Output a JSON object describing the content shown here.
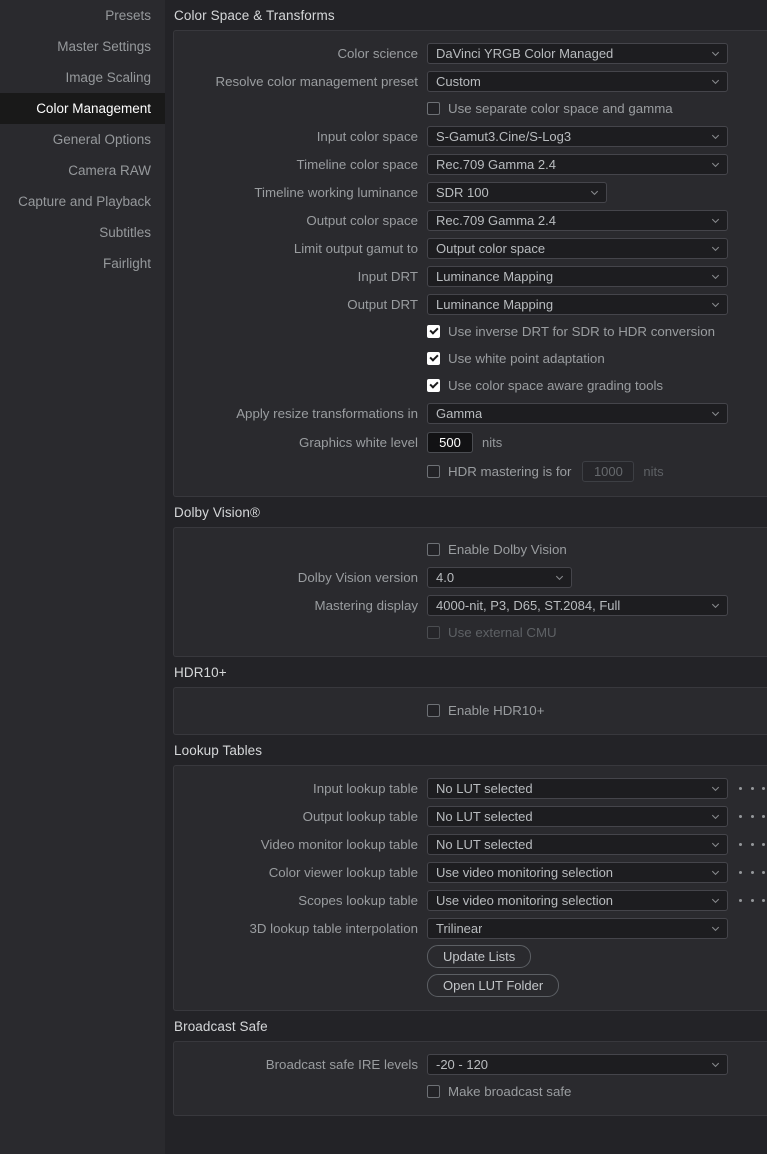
{
  "sidebar": {
    "items": [
      {
        "label": "Presets",
        "active": false
      },
      {
        "label": "Master Settings",
        "active": false
      },
      {
        "label": "Image Scaling",
        "active": false
      },
      {
        "label": "Color Management",
        "active": true
      },
      {
        "label": "General Options",
        "active": false
      },
      {
        "label": "Camera RAW",
        "active": false
      },
      {
        "label": "Capture and Playback",
        "active": false
      },
      {
        "label": "Subtitles",
        "active": false
      },
      {
        "label": "Fairlight",
        "active": false
      }
    ]
  },
  "sections": {
    "color_space_transforms": {
      "title": "Color Space & Transforms",
      "color_science": {
        "label": "Color science",
        "value": "DaVinci YRGB Color Managed"
      },
      "preset": {
        "label": "Resolve color management preset",
        "value": "Custom"
      },
      "separate_cs_gamma": {
        "label": "Use separate color space and gamma",
        "checked": false
      },
      "input_color_space": {
        "label": "Input color space",
        "value": "S-Gamut3.Cine/S-Log3"
      },
      "timeline_color_space": {
        "label": "Timeline color space",
        "value": "Rec.709 Gamma 2.4"
      },
      "timeline_working_luminance": {
        "label": "Timeline working luminance",
        "value": "SDR 100"
      },
      "output_color_space": {
        "label": "Output color space",
        "value": "Rec.709 Gamma 2.4"
      },
      "limit_output_gamut": {
        "label": "Limit output gamut to",
        "value": "Output color space"
      },
      "input_drt": {
        "label": "Input DRT",
        "value": "Luminance Mapping"
      },
      "output_drt": {
        "label": "Output DRT",
        "value": "Luminance Mapping"
      },
      "inverse_drt": {
        "label": "Use inverse DRT for SDR to HDR conversion",
        "checked": true
      },
      "white_point_adaptation": {
        "label": "Use white point adaptation",
        "checked": true
      },
      "cs_aware_grading": {
        "label": "Use color space aware grading tools",
        "checked": true
      },
      "apply_resize": {
        "label": "Apply resize transformations in",
        "value": "Gamma"
      },
      "graphics_white_level": {
        "label": "Graphics white level",
        "value": "500",
        "unit": "nits"
      },
      "hdr_mastering": {
        "label": "HDR mastering is for",
        "checked": false,
        "value": "1000",
        "unit": "nits"
      }
    },
    "dolby_vision": {
      "title": "Dolby Vision®",
      "enable": {
        "label": "Enable Dolby Vision",
        "checked": false
      },
      "version": {
        "label": "Dolby Vision version",
        "value": "4.0"
      },
      "mastering_display": {
        "label": "Mastering display",
        "value": "4000-nit, P3, D65, ST.2084, Full"
      },
      "external_cmu": {
        "label": "Use external CMU",
        "checked": false
      }
    },
    "hdr10plus": {
      "title": "HDR10+",
      "enable": {
        "label": "Enable HDR10+",
        "checked": false
      }
    },
    "lookup_tables": {
      "title": "Lookup Tables",
      "rows": [
        {
          "label": "Input lookup table",
          "value": "No LUT selected",
          "has_browse": true
        },
        {
          "label": "Output lookup table",
          "value": "No LUT selected",
          "has_browse": true
        },
        {
          "label": "Video monitor lookup table",
          "value": "No LUT selected",
          "has_browse": true
        },
        {
          "label": "Color viewer lookup table",
          "value": "Use video monitoring selection",
          "has_browse": true
        },
        {
          "label": "Scopes lookup table",
          "value": "Use video monitoring selection",
          "has_browse": true
        },
        {
          "label": "3D lookup table interpolation",
          "value": "Trilinear",
          "has_browse": false
        }
      ],
      "update_lists_button": "Update Lists",
      "open_lut_folder_button": "Open LUT Folder"
    },
    "broadcast_safe": {
      "title": "Broadcast Safe",
      "ire_levels": {
        "label": "Broadcast safe IRE levels",
        "value": "-20 - 120"
      },
      "make_safe": {
        "label": "Make broadcast safe",
        "checked": false
      }
    }
  },
  "icons": {
    "chevron_down": "chevron-down-icon",
    "ellipsis": "ellipsis-icon",
    "checkmark": "check-icon"
  },
  "colors": {
    "background": "#232327",
    "panel": "#2a2a2e",
    "sidebar": "#2a2a2e",
    "active_item": "#191919",
    "field": "#1d1d20",
    "border": "#45454b",
    "text": "#b4b7ba",
    "label": "#9a9da0",
    "disabled": "#5e6165"
  }
}
